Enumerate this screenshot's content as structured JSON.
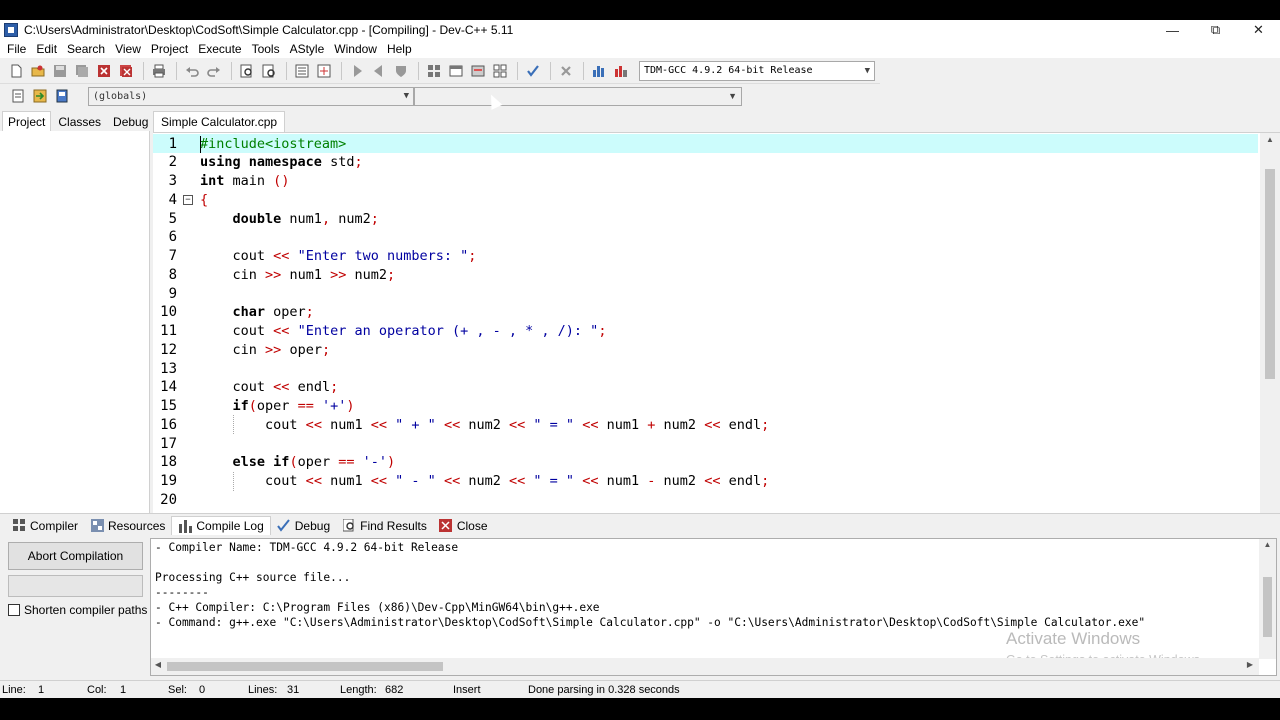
{
  "window": {
    "title": "C:\\Users\\Administrator\\Desktop\\CodSoft\\Simple Calculator.cpp - [Compiling] - Dev-C++ 5.11",
    "min_label": "—",
    "max_label": "⧉",
    "close_label": "✕"
  },
  "menu": [
    "File",
    "Edit",
    "Search",
    "View",
    "Project",
    "Execute",
    "Tools",
    "AStyle",
    "Window",
    "Help"
  ],
  "toolbar": {
    "compiler": "TDM-GCC 4.9.2 64-bit Release",
    "globals": "(globals)",
    "function": ""
  },
  "left_panel": {
    "tabs": [
      "Project",
      "Classes",
      "Debug"
    ],
    "active_tab": "Project"
  },
  "editor": {
    "file_tab": "Simple Calculator.cpp",
    "current_line": 1,
    "lines": [
      {
        "n": "1",
        "code": "#include<iostream>"
      },
      {
        "n": "2",
        "code": "using namespace std;"
      },
      {
        "n": "3",
        "code": "int main ()"
      },
      {
        "n": "4",
        "code": "{"
      },
      {
        "n": "5",
        "code": "    double num1, num2;"
      },
      {
        "n": "6",
        "code": ""
      },
      {
        "n": "7",
        "code": "    cout << \"Enter two numbers: \";"
      },
      {
        "n": "8",
        "code": "    cin >> num1 >> num2;"
      },
      {
        "n": "9",
        "code": ""
      },
      {
        "n": "10",
        "code": "    char oper;"
      },
      {
        "n": "11",
        "code": "    cout << \"Enter an operator (+ , - , * , /): \";"
      },
      {
        "n": "12",
        "code": "    cin >> oper;"
      },
      {
        "n": "13",
        "code": ""
      },
      {
        "n": "14",
        "code": "    cout << endl;"
      },
      {
        "n": "15",
        "code": "    if(oper == '+')"
      },
      {
        "n": "16",
        "code": "        cout << num1 << \" + \" << num2 << \" = \" << num1 + num2 << endl;"
      },
      {
        "n": "17",
        "code": ""
      },
      {
        "n": "18",
        "code": "    else if(oper == '-')"
      },
      {
        "n": "19",
        "code": "        cout << num1 << \" - \" << num2 << \" = \" << num1 - num2 << endl;"
      },
      {
        "n": "20",
        "code": ""
      }
    ]
  },
  "bottom_tabs": [
    {
      "label": "Compiler",
      "icon": "compiler-grid-icon"
    },
    {
      "label": "Resources",
      "icon": "resources-icon"
    },
    {
      "label": "Compile Log",
      "icon": "compile-log-chart-icon"
    },
    {
      "label": "Debug",
      "icon": "debug-check-icon"
    },
    {
      "label": "Find Results",
      "icon": "find-results-icon"
    },
    {
      "label": "Close",
      "icon": "close-panel-icon"
    }
  ],
  "active_bottom_tab": "Compile Log",
  "bottom_left": {
    "abort_label": "Abort Compilation",
    "shorten_label": "Shorten compiler paths",
    "shorten_checked": false
  },
  "log": {
    "lines": [
      "- Compiler Name: TDM-GCC 4.9.2 64-bit Release",
      "",
      "Processing C++ source file...",
      "--------",
      "- C++ Compiler: C:\\Program Files (x86)\\Dev-Cpp\\MinGW64\\bin\\g++.exe",
      "- Command: g++.exe \"C:\\Users\\Administrator\\Desktop\\CodSoft\\Simple Calculator.cpp\" -o \"C:\\Users\\Administrator\\Desktop\\CodSoft\\Simple Calculator.exe\""
    ],
    "watermark_title": "Activate Windows",
    "watermark_sub": "Go to Settings to activate Windows."
  },
  "status": {
    "line_label": "Line:",
    "line_value": "1",
    "col_label": "Col:",
    "col_value": "1",
    "sel_label": "Sel:",
    "sel_value": "0",
    "lines_label": "Lines:",
    "lines_value": "31",
    "length_label": "Length:",
    "length_value": "682",
    "mode": "Insert",
    "message": "Done parsing in 0.328 seconds"
  },
  "colors": {
    "keyword": "#000000",
    "symbol": "#c00000",
    "string": "#0000a0",
    "preprocessor": "#008000",
    "current_line_bg": "#ccfcfc"
  }
}
